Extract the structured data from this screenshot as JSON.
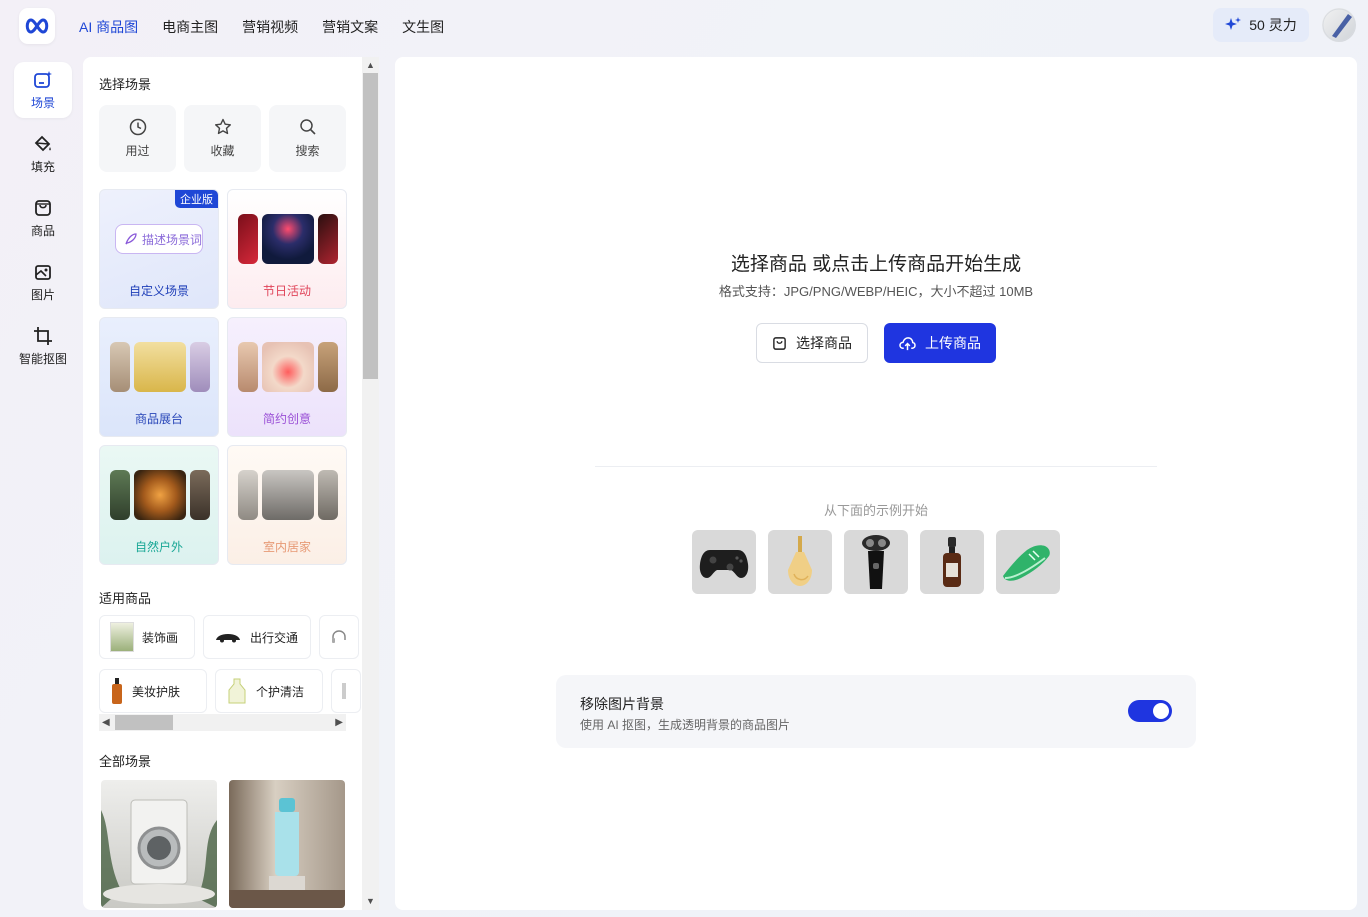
{
  "topbar": {
    "nav": [
      "AI 商品图",
      "电商主图",
      "营销视频",
      "营销文案",
      "文生图"
    ],
    "points_label": "50 灵力"
  },
  "leftnav": {
    "items": [
      {
        "label": "场景",
        "icon": "scene-icon"
      },
      {
        "label": "填充",
        "icon": "fill-bucket-icon"
      },
      {
        "label": "商品",
        "icon": "shopping-bag-icon"
      },
      {
        "label": "图片",
        "icon": "image-icon"
      },
      {
        "label": "智能抠图",
        "icon": "crop-icon"
      }
    ]
  },
  "panel": {
    "select_scene_title": "选择场景",
    "quick": [
      {
        "label": "用过",
        "icon": "clock-icon"
      },
      {
        "label": "收藏",
        "icon": "star-icon"
      },
      {
        "label": "搜索",
        "icon": "search-icon"
      }
    ],
    "scenes": [
      {
        "label": "自定义场景",
        "badge": "企业版",
        "input_placeholder": "描述场景词",
        "color": "#1f3fb8"
      },
      {
        "label": "节日活动",
        "color": "#e0455a"
      },
      {
        "label": "商品展台",
        "color": "#2846b8"
      },
      {
        "label": "简约创意",
        "color": "#9a4fd6"
      },
      {
        "label": "自然户外",
        "color": "#1aa796"
      },
      {
        "label": "室内居家",
        "color": "#e79a76"
      }
    ],
    "products_title": "适用商品",
    "products": [
      "装饰画",
      "出行交通",
      "美妆护肤",
      "个护清洁"
    ],
    "all_scenes_title": "全部场景"
  },
  "main": {
    "title": "选择商品 或点击上传商品开始生成",
    "subtitle": "格式支持：JPG/PNG/WEBP/HEIC，大小不超过 10MB",
    "select_button": "选择商品",
    "upload_button": "上传商品",
    "examples_title": "从下面的示例开始",
    "examples": [
      "game-controller",
      "perfume-bottle",
      "electric-shaver",
      "serum-dropper-bottle",
      "green-sneaker"
    ],
    "remove_bg": {
      "title": "移除图片背景",
      "desc": "使用 AI 抠图，生成透明背景的商品图片",
      "enabled": true
    }
  },
  "colors": {
    "accent": "#1f47d6",
    "button_primary": "#1f35e0"
  }
}
